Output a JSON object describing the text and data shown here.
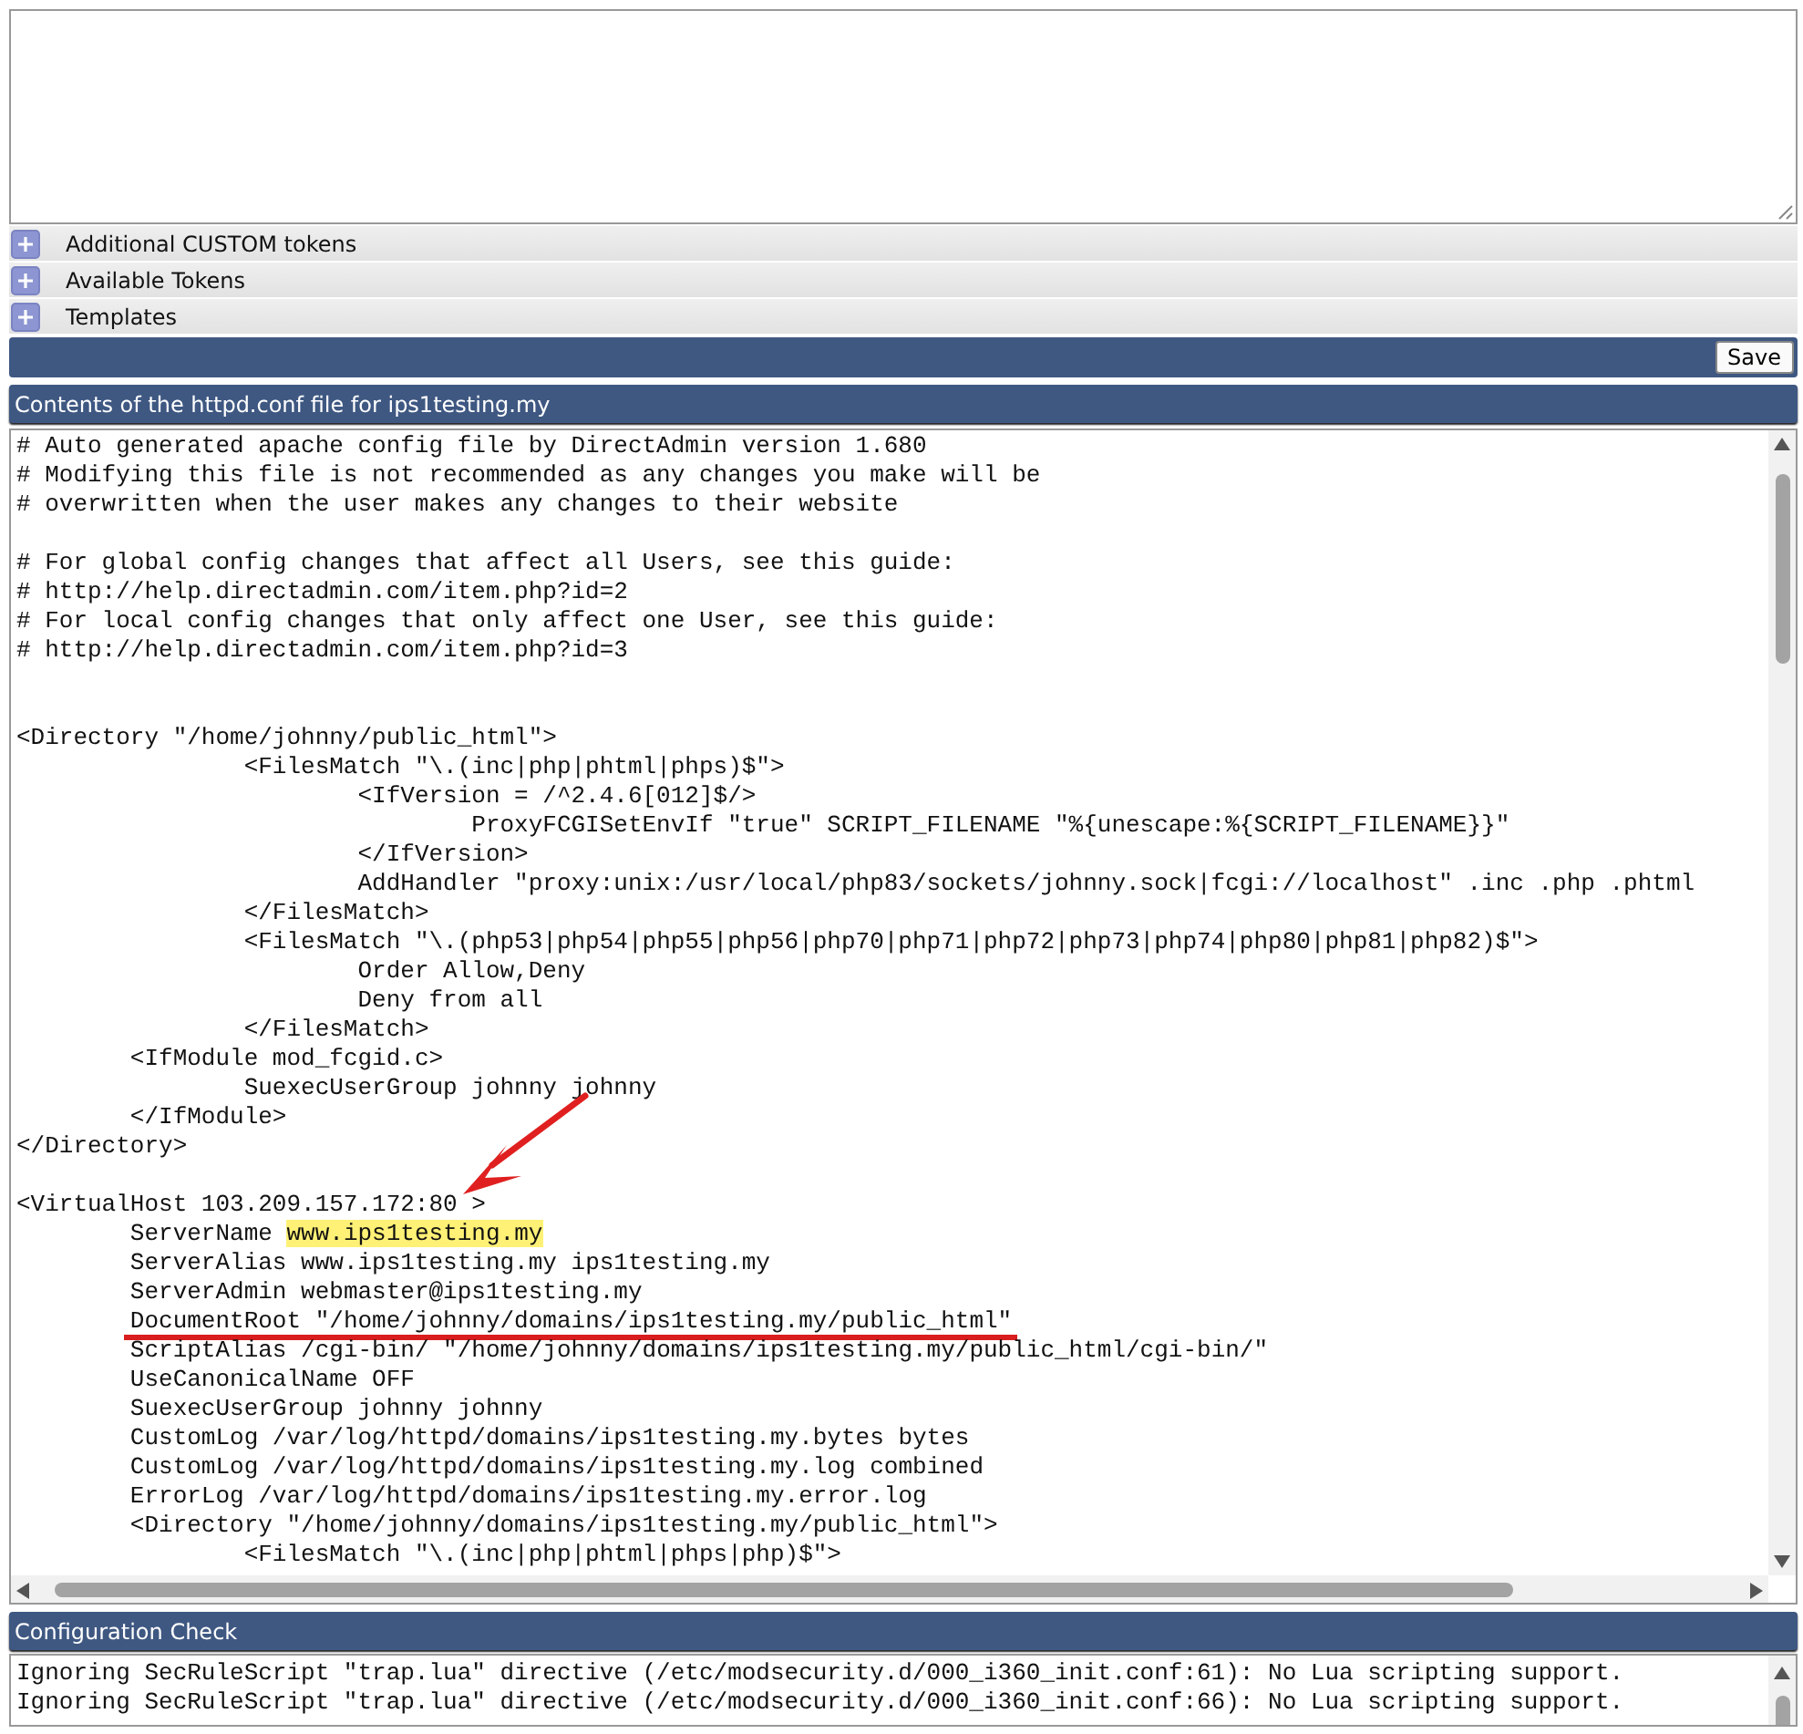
{
  "tokens": [
    {
      "label": "Additional CUSTOM tokens",
      "expanded": false
    },
    {
      "label": "Available Tokens",
      "expanded": false
    },
    {
      "label": "Templates",
      "expanded": false
    }
  ],
  "save_button": "Save",
  "config_file": {
    "title": "Contents of the httpd.conf file for ips1testing.my",
    "lines": [
      {
        "kind": "code",
        "text": "# Auto generated apache config file by DirectAdmin version 1.680"
      },
      {
        "kind": "code",
        "text": "# Modifying this file is not recommended as any changes you make will be"
      },
      {
        "kind": "code",
        "text": "# overwritten when the user makes any changes to their website"
      },
      {
        "kind": "blank"
      },
      {
        "kind": "code",
        "text": "# For global config changes that affect all Users, see this guide:"
      },
      {
        "kind": "code",
        "text": "# http://help.directadmin.com/item.php?id=2"
      },
      {
        "kind": "code",
        "text": "# For local config changes that only affect one User, see this guide:"
      },
      {
        "kind": "code",
        "text": "# http://help.directadmin.com/item.php?id=3"
      },
      {
        "kind": "blank"
      },
      {
        "kind": "blank"
      },
      {
        "kind": "code",
        "text": "<Directory \"/home/johnny/public_html\">"
      },
      {
        "kind": "code",
        "text": "\t\t<FilesMatch \"\\.(inc|php|phtml|phps)$\">"
      },
      {
        "kind": "code",
        "text": "\t\t\t<IfVersion = /^2.4.6[012]$/>"
      },
      {
        "kind": "code",
        "text": "\t\t\t\tProxyFCGISetEnvIf \"true\" SCRIPT_FILENAME \"%{unescape:%{SCRIPT_FILENAME}}\""
      },
      {
        "kind": "code",
        "text": "\t\t\t</IfVersion>"
      },
      {
        "kind": "code",
        "text": "\t\t\tAddHandler \"proxy:unix:/usr/local/php83/sockets/johnny.sock|fcgi://localhost\" .inc .php .phtml"
      },
      {
        "kind": "code",
        "text": "\t\t</FilesMatch>"
      },
      {
        "kind": "code",
        "text": "\t\t<FilesMatch \"\\.(php53|php54|php55|php56|php70|php71|php72|php73|php74|php80|php81|php82)$\">"
      },
      {
        "kind": "code",
        "text": "\t\t\tOrder Allow,Deny"
      },
      {
        "kind": "code",
        "text": "\t\t\tDeny from all"
      },
      {
        "kind": "code",
        "text": "\t\t</FilesMatch>"
      },
      {
        "kind": "code",
        "text": "\t<IfModule mod_fcgid.c>"
      },
      {
        "kind": "code",
        "text": "\t\tSuexecUserGroup johnny johnny"
      },
      {
        "kind": "code",
        "text": "\t</IfModule>"
      },
      {
        "kind": "code",
        "text": "</Directory>"
      },
      {
        "kind": "blank"
      },
      {
        "kind": "code",
        "text": "<VirtualHost 103.209.157.172:80 >"
      },
      {
        "kind": "highlighted",
        "text": "\tServerName ",
        "mark": "www.ips1testing.my"
      },
      {
        "kind": "code",
        "text": "\tServerAlias www.ips1testing.my ips1testing.my"
      },
      {
        "kind": "code",
        "text": "\tServerAdmin webmaster@ips1testing.my"
      },
      {
        "kind": "underlined",
        "text": "\tDocumentRoot \"/home/johnny/domains/ips1testing.my/public_html\""
      },
      {
        "kind": "code",
        "text": "\tScriptAlias /cgi-bin/ \"/home/johnny/domains/ips1testing.my/public_html/cgi-bin/\""
      },
      {
        "kind": "code",
        "text": "\tUseCanonicalName OFF"
      },
      {
        "kind": "code",
        "text": "\tSuexecUserGroup johnny johnny"
      },
      {
        "kind": "code",
        "text": "\tCustomLog /var/log/httpd/domains/ips1testing.my.bytes bytes"
      },
      {
        "kind": "code",
        "text": "\tCustomLog /var/log/httpd/domains/ips1testing.my.log combined"
      },
      {
        "kind": "code",
        "text": "\tErrorLog /var/log/httpd/domains/ips1testing.my.error.log"
      },
      {
        "kind": "code",
        "text": "\t<Directory \"/home/johnny/domains/ips1testing.my/public_html\">"
      },
      {
        "kind": "code",
        "text": "\t\t<FilesMatch \"\\.(inc|php|phtml|phps|php)$\">"
      }
    ]
  },
  "config_check": {
    "title": "Configuration Check",
    "lines": [
      "Ignoring SecRuleScript \"trap.lua\" directive (/etc/modsecurity.d/000_i360_init.conf:61): No Lua scripting support.",
      "Ignoring SecRuleScript \"trap.lua\" directive (/etc/modsecurity.d/000_i360_init.conf:66): No Lua scripting support."
    ]
  }
}
